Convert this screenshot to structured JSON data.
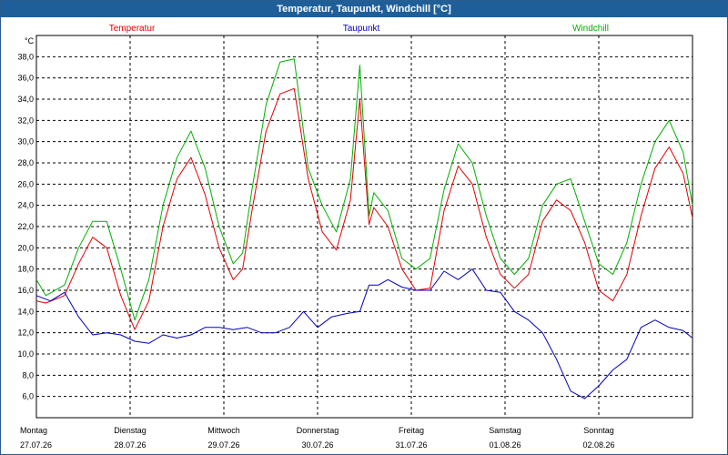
{
  "window": {
    "title": "Temperatur, Taupunkt, Windchill [°C]"
  },
  "chart_data": {
    "type": "line",
    "title": "Temperatur, Taupunkt, Windchill [°C]",
    "unit": "°C",
    "ylim": [
      4,
      40
    ],
    "yticks": [
      6,
      8,
      10,
      12,
      14,
      16,
      18,
      20,
      22,
      24,
      26,
      28,
      30,
      32,
      34,
      36,
      38
    ],
    "ytick_labels": [
      "6,0",
      "8,0",
      "10,0",
      "12,0",
      "14,0",
      "16,0",
      "18,0",
      "20,0",
      "22,0",
      "24,0",
      "26,0",
      "28,0",
      "30,0",
      "32,0",
      "34,0",
      "36,0",
      "38,0"
    ],
    "xlim": [
      0,
      7
    ],
    "grid": true,
    "legend_placement": "top",
    "days": [
      {
        "weekday": "Montag",
        "date": "27.07.26"
      },
      {
        "weekday": "Dienstag",
        "date": "28.07.26"
      },
      {
        "weekday": "Mittwoch",
        "date": "29.07.26"
      },
      {
        "weekday": "Donnerstag",
        "date": "30.07.26"
      },
      {
        "weekday": "Freitag",
        "date": "31.07.26"
      },
      {
        "weekday": "Samstag",
        "date": "01.08.26"
      },
      {
        "weekday": "Sonntag",
        "date": "02.08.26"
      }
    ],
    "series": [
      {
        "name": "Temperatur",
        "color": "#e00000",
        "x": [
          0,
          0.1,
          0.3,
          0.45,
          0.6,
          0.75,
          0.9,
          1.05,
          1.2,
          1.35,
          1.5,
          1.65,
          1.8,
          1.95,
          2.1,
          2.2,
          2.3,
          2.45,
          2.6,
          2.75,
          2.9,
          3.05,
          3.2,
          3.35,
          3.45,
          3.55,
          3.6,
          3.75,
          3.9,
          4.05,
          4.2,
          4.35,
          4.5,
          4.65,
          4.8,
          4.95,
          5.1,
          5.25,
          5.4,
          5.55,
          5.7,
          5.85,
          6.0,
          6.15,
          6.3,
          6.45,
          6.6,
          6.75,
          6.9,
          7.0
        ],
        "y": [
          15.0,
          14.8,
          15.5,
          18.5,
          21.0,
          20.0,
          15.5,
          12.3,
          15.0,
          22.0,
          26.5,
          28.5,
          25.0,
          20.0,
          17.0,
          18.0,
          23.5,
          31.0,
          34.5,
          35.0,
          26.5,
          21.5,
          19.8,
          24.5,
          34.0,
          22.2,
          23.8,
          22.0,
          18.0,
          16.0,
          16.2,
          23.5,
          27.7,
          26.0,
          21.0,
          17.5,
          16.2,
          17.5,
          22.5,
          24.5,
          23.5,
          20.5,
          16.0,
          15.0,
          17.5,
          23.0,
          27.5,
          29.5,
          27.0,
          22.8
        ]
      },
      {
        "name": "Taupunkt",
        "color": "#0000c0",
        "x": [
          0,
          0.15,
          0.3,
          0.45,
          0.6,
          0.75,
          0.9,
          1.05,
          1.2,
          1.35,
          1.5,
          1.65,
          1.8,
          1.95,
          2.1,
          2.25,
          2.4,
          2.55,
          2.7,
          2.85,
          3.0,
          3.15,
          3.3,
          3.45,
          3.55,
          3.65,
          3.75,
          3.9,
          4.05,
          4.2,
          4.35,
          4.5,
          4.65,
          4.8,
          4.95,
          5.1,
          5.25,
          5.4,
          5.55,
          5.7,
          5.85,
          6.0,
          6.15,
          6.3,
          6.45,
          6.6,
          6.75,
          6.9,
          7.0
        ],
        "y": [
          15.5,
          15.0,
          15.8,
          13.5,
          11.8,
          12.0,
          11.8,
          11.2,
          11.0,
          11.8,
          11.5,
          11.8,
          12.5,
          12.5,
          12.3,
          12.5,
          12.0,
          12.0,
          12.5,
          14.0,
          12.5,
          13.5,
          13.8,
          14.0,
          16.5,
          16.5,
          17.0,
          16.3,
          16.0,
          16.0,
          17.8,
          17.0,
          18.0,
          16.0,
          15.8,
          14.0,
          13.2,
          12.0,
          9.5,
          6.5,
          5.8,
          7.0,
          8.5,
          9.5,
          12.5,
          13.2,
          12.5,
          12.2,
          11.5
        ]
      },
      {
        "name": "Windchill",
        "color": "#00b000",
        "x": [
          0,
          0.1,
          0.3,
          0.45,
          0.6,
          0.75,
          0.9,
          1.05,
          1.2,
          1.35,
          1.5,
          1.65,
          1.8,
          1.95,
          2.1,
          2.2,
          2.3,
          2.45,
          2.6,
          2.75,
          2.9,
          3.05,
          3.2,
          3.35,
          3.45,
          3.55,
          3.6,
          3.75,
          3.9,
          4.05,
          4.2,
          4.35,
          4.5,
          4.65,
          4.8,
          4.95,
          5.1,
          5.25,
          5.4,
          5.55,
          5.7,
          5.85,
          6.0,
          6.15,
          6.3,
          6.45,
          6.6,
          6.75,
          6.9,
          7.0
        ],
        "y": [
          17.0,
          15.5,
          16.5,
          20.0,
          22.5,
          22.5,
          18.0,
          13.2,
          17.0,
          24.0,
          28.5,
          31.0,
          27.5,
          22.0,
          18.5,
          19.5,
          25.5,
          33.5,
          37.5,
          37.8,
          27.5,
          24.0,
          21.5,
          26.5,
          37.2,
          23.0,
          25.2,
          23.5,
          19.0,
          18.0,
          19.0,
          25.5,
          29.8,
          28.0,
          23.0,
          19.0,
          17.5,
          19.0,
          24.0,
          26.0,
          26.5,
          22.5,
          18.5,
          17.5,
          20.5,
          26.0,
          30.0,
          32.0,
          29.0,
          24.0
        ]
      }
    ]
  }
}
